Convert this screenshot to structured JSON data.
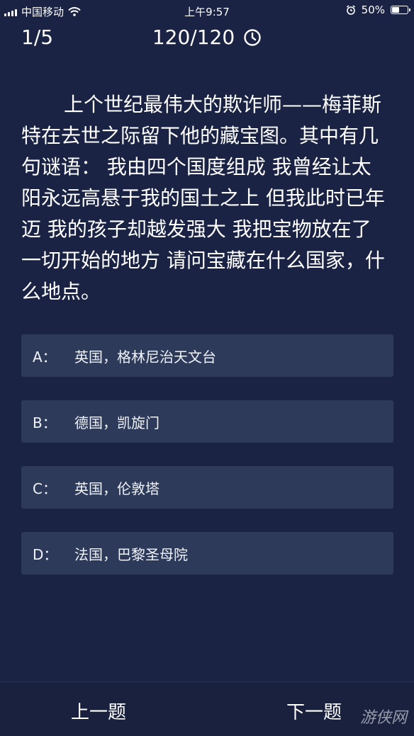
{
  "status_bar": {
    "carrier": "中国移动",
    "time": "上午9:57",
    "battery": "50%",
    "battery_level": 0.5
  },
  "header": {
    "progress": "1/5",
    "timer": "120/120"
  },
  "question": {
    "text": "上个世纪最伟大的欺诈师——梅菲斯特在去世之际留下他的藏宝图。其中有几句谜语： 我由四个国度组成 我曾经让太阳永远高悬于我的国土之上 但我此时已年迈 我的孩子却越发强大 我把宝物放在了一切开始的地方 请问宝藏在什么国家，什么地点。"
  },
  "options": [
    {
      "letter": "A：",
      "text": "英国，格林尼治天文台"
    },
    {
      "letter": "B：",
      "text": "德国，凯旋门"
    },
    {
      "letter": "C：",
      "text": "英国，伦敦塔"
    },
    {
      "letter": "D：",
      "text": "法国，巴黎圣母院"
    }
  ],
  "nav": {
    "prev": "上一题",
    "next": "下一题"
  },
  "watermark": "游侠网",
  "colors": {
    "background": "#1a2343",
    "option_background": "#2d3a5a",
    "text": "#ffffff"
  }
}
